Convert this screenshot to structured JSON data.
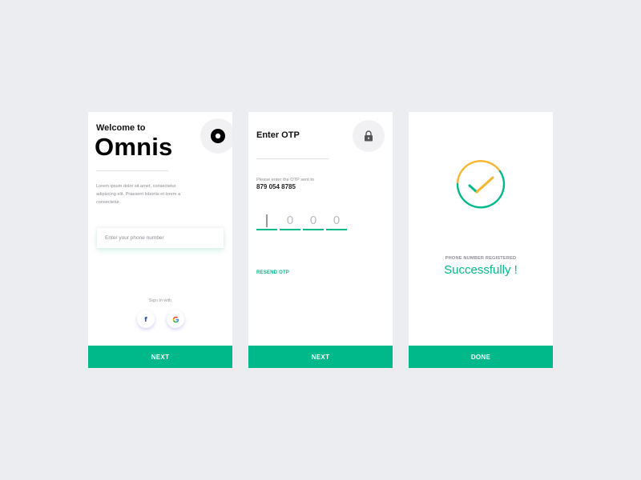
{
  "welcome_screen": {
    "greeting": "Welcome to",
    "brand": "Omnis",
    "body": "Lorem ipsum dolor sit amet, consectetur adipiscing elit. Praesent lobortis et lorem a consectetur.",
    "phone_placeholder": "Enter your phone number",
    "sign_in_label": "Sign In with",
    "social_icons": [
      "facebook-icon",
      "google-icon"
    ],
    "facebook_glyph": "f",
    "cta": "NEXT"
  },
  "otp_screen": {
    "title": "Enter OTP",
    "hint": "Please enter the OTP sent to",
    "phone": "879 054 8785",
    "digits": [
      "",
      "0",
      "0",
      "0"
    ],
    "resend": "RESEND OTP",
    "icon": "lock-icon",
    "cta": "NEXT"
  },
  "success_screen": {
    "label": "PHONE NUMBER REGISTERED",
    "message": "Successfully !",
    "icon": "check-circle-icon",
    "cta": "DONE"
  },
  "colors": {
    "background": "#ecedf1",
    "accent": "#00b98a",
    "highlight": "#f5b730",
    "card": "#ffffff"
  }
}
